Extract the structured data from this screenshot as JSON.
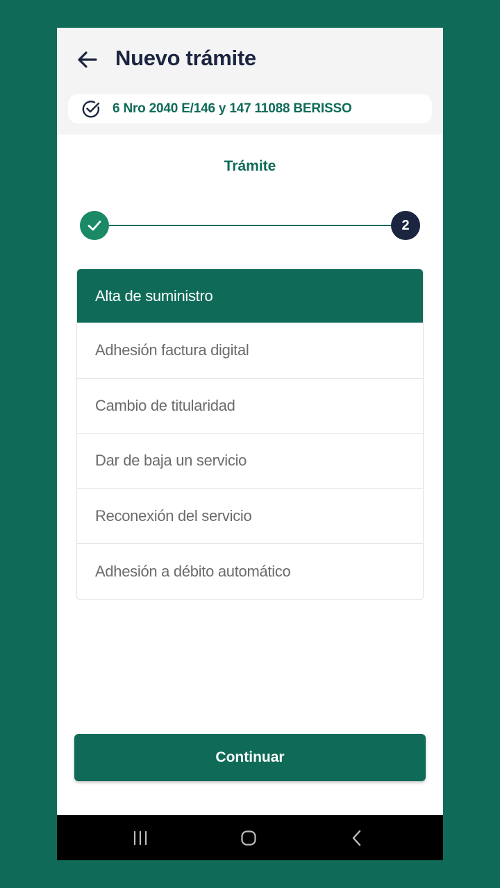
{
  "header": {
    "title": "Nuevo trámite",
    "back_icon": "arrow-left-icon",
    "address": "6 Nro 2040 E/146 y 147 11088 BERISSO",
    "address_icon": "check-circle-icon"
  },
  "stepper": {
    "title": "Trámite",
    "current_step": "2",
    "completed_icon": "check-icon"
  },
  "options": [
    {
      "label": "Alta de suministro",
      "selected": true
    },
    {
      "label": "Adhesión factura digital",
      "selected": false
    },
    {
      "label": "Cambio de titularidad",
      "selected": false
    },
    {
      "label": "Dar de baja un servicio",
      "selected": false
    },
    {
      "label": "Reconexión del servicio",
      "selected": false
    },
    {
      "label": "Adhesión a débito automático",
      "selected": false
    }
  ],
  "actions": {
    "continue_label": "Continuar"
  },
  "system_nav": {
    "recents_icon": "recents-icon",
    "home_icon": "home-icon",
    "back_icon": "nav-back-icon"
  },
  "colors": {
    "brand_green": "#0f6b58",
    "step_done": "#1a8a66",
    "dark_navy": "#1b2540",
    "header_bg": "#f4f4f4"
  }
}
